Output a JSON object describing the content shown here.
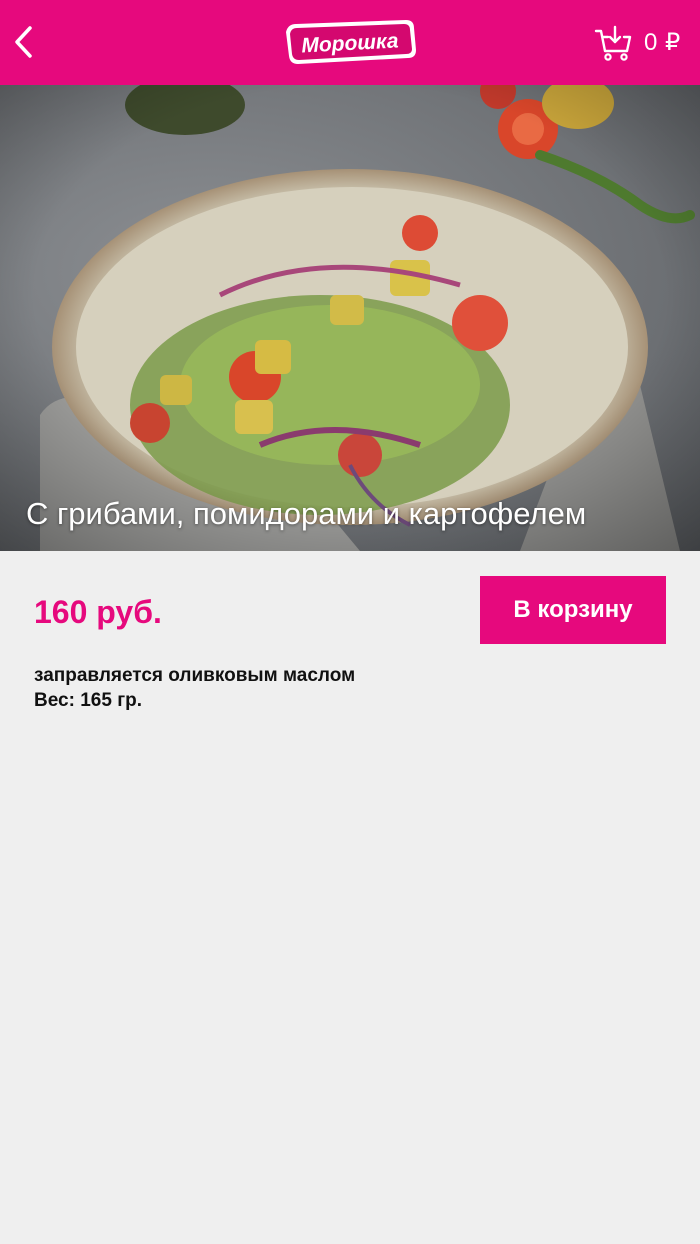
{
  "header": {
    "logo_text": "Морошка",
    "cart_total": "0 ₽",
    "icons": {
      "back": "chevron-left-icon",
      "cart": "cart-icon"
    },
    "colors": {
      "brand": "#e6097d",
      "header_text": "#ffffff"
    }
  },
  "product": {
    "title": "С грибами, помидорами и картофелем",
    "price": "160 руб.",
    "add_to_cart_label": "В корзину",
    "description": "заправляется оливковым маслом",
    "weight": "Вес: 165 гр."
  },
  "colors": {
    "background": "#efefef",
    "accent": "#e6097d",
    "text": "#111111"
  }
}
